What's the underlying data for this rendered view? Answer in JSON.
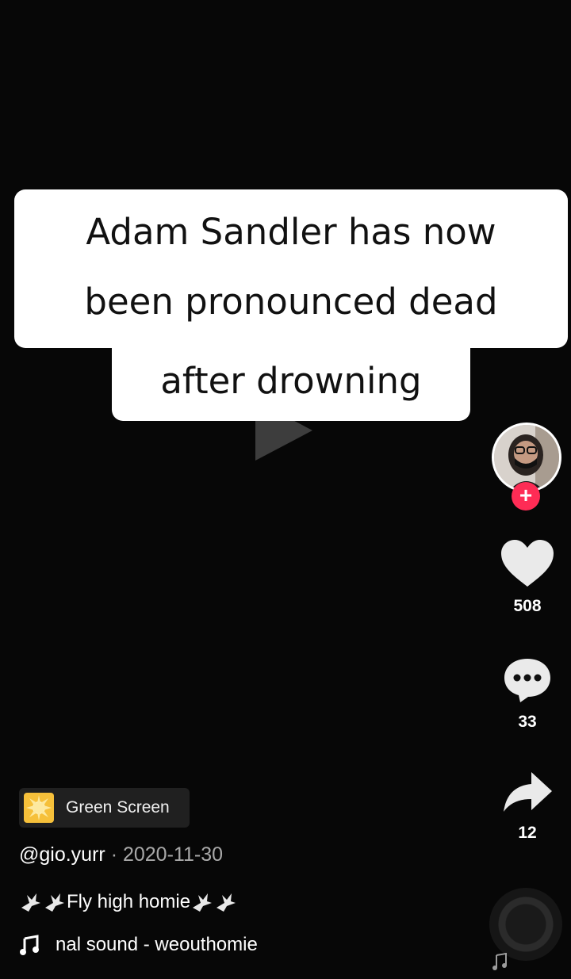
{
  "caption": {
    "line1": "Adam Sandler has now",
    "line2": "been pronounced dead",
    "line3": "after drowning"
  },
  "actions": {
    "likes": "508",
    "comments": "33",
    "shares": "12",
    "follow_symbol": "+"
  },
  "effect": {
    "label": "Green Screen",
    "icon": "green-screen-effect-icon"
  },
  "post": {
    "author": "@gio.yurr",
    "date": "· 2020-11-30",
    "description": "Fly high homie",
    "sound": "nal sound - weouthomie"
  },
  "colors": {
    "follow": "#fe2c55",
    "background": "#070707",
    "effect": "#f6c03a"
  }
}
